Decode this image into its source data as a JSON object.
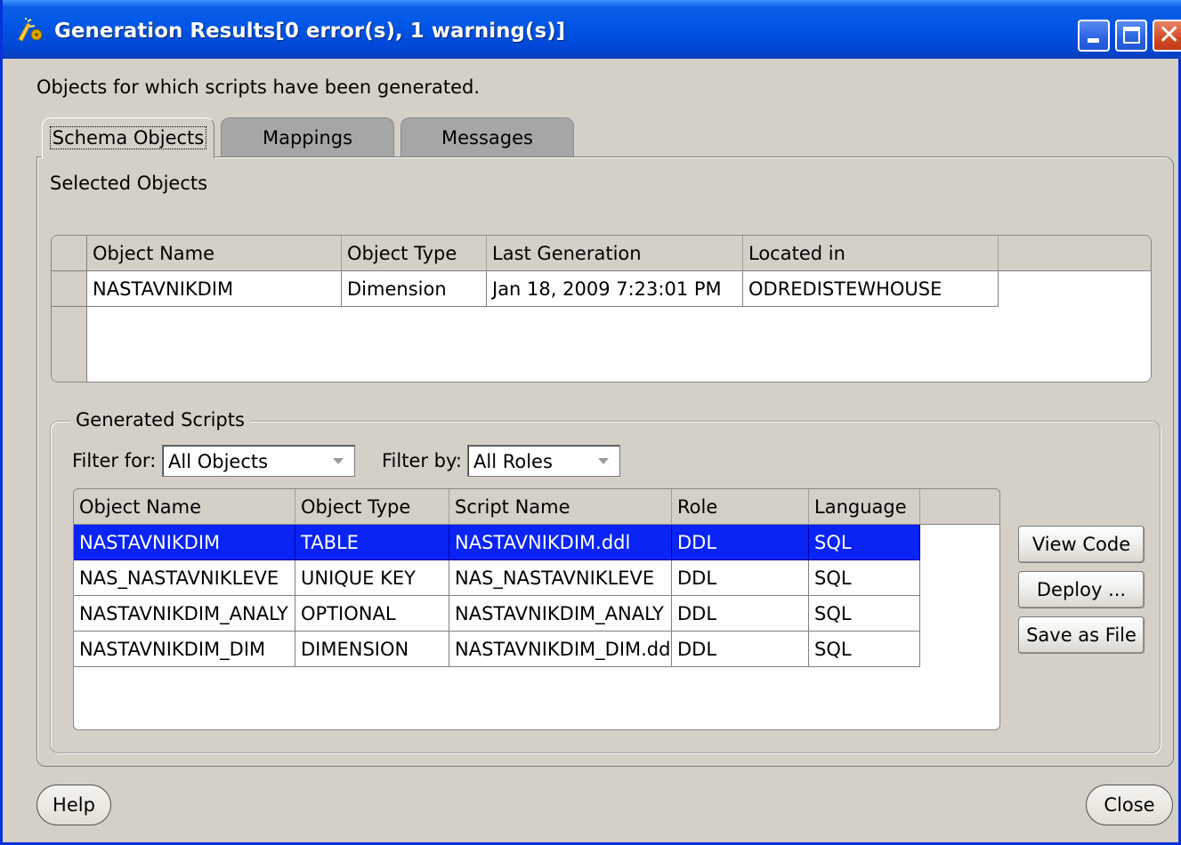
{
  "window": {
    "title": "Generation Results[0 error(s), 1 warning(s)]",
    "description": "Objects for which scripts have been generated."
  },
  "tabs": [
    {
      "label": "Schema Objects",
      "selected": true
    },
    {
      "label": "Mappings",
      "selected": false
    },
    {
      "label": "Messages",
      "selected": false
    }
  ],
  "selected_objects": {
    "label": "Selected Objects",
    "columns": [
      "Object Name",
      "Object Type",
      "Last Generation",
      "Located in"
    ],
    "rows": [
      [
        "NASTAVNIKDIM",
        "Dimension",
        "Jan 18, 2009 7:23:01 PM",
        "ODREDISTEWHOUSE"
      ]
    ]
  },
  "generated_scripts": {
    "label": "Generated Scripts",
    "filter_for_label": "Filter for:",
    "filter_for_value": "All Objects",
    "filter_by_label": "Filter by:",
    "filter_by_value": "All Roles",
    "columns": [
      "Object Name",
      "Object Type",
      "Script Name",
      "Role",
      "Language"
    ],
    "rows": [
      [
        "NASTAVNIKDIM",
        "TABLE",
        "NASTAVNIKDIM.ddl",
        "DDL",
        "SQL"
      ],
      [
        "NAS_NASTAVNIKLEVE",
        "UNIQUE KEY",
        "NAS_NASTAVNIKLEVE",
        "DDL",
        "SQL"
      ],
      [
        "NASTAVNIKDIM_ANALY",
        "OPTIONAL",
        "NASTAVNIKDIM_ANALY",
        "DDL",
        "SQL"
      ],
      [
        "NASTAVNIKDIM_DIM",
        "DIMENSION",
        "NASTAVNIKDIM_DIM.dd",
        "DDL",
        "SQL"
      ]
    ],
    "selected_row": 0
  },
  "buttons": {
    "view_code": "View Code",
    "deploy": "Deploy ...",
    "save_as_file": "Save as File",
    "help": "Help",
    "close": "Close"
  },
  "colors": {
    "title_bar": "#0055e5",
    "selection": "#0a24f5",
    "dialog_bg": "#d4d0c8"
  }
}
